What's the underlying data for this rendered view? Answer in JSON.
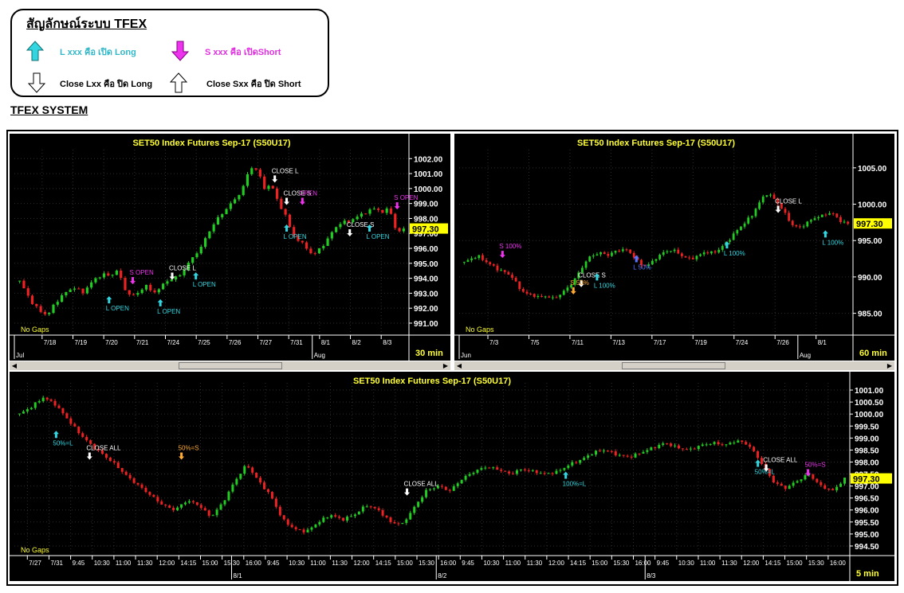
{
  "legend": {
    "title": "สัญลักษณ์ระบบ TFEX",
    "open_long": "L xxx คือ เปิด Long",
    "open_short": "S xxx คือ เปิดShort",
    "close_long": "Close Lxx คือ ปิด Long",
    "close_short": "Close Sxx คือ ปิด Short"
  },
  "system_title": "TFEX SYSTEM",
  "colors": {
    "up": "#22cc22",
    "down": "#ee2222",
    "long": "#33d6e0",
    "short": "#ee33ee",
    "close": "#ffffff",
    "partial": "#ffaa33",
    "blue": "#5577ff",
    "title": "#ffff33",
    "price_tag": "#ffff00"
  },
  "chart_data": [
    {
      "type": "candlestick",
      "title": "SET50  Index  Futures  Sep-17  (S50U17)",
      "timeframe": "30  min",
      "footer": "No  Gaps",
      "last_price": "997.30",
      "ylim": [
        990.2,
        1002.6
      ],
      "y_ticks": [
        "1002.00",
        "1001.00",
        "1000.00",
        "999.00",
        "998.00",
        "997.00",
        "996.00",
        "995.00",
        "994.00",
        "993.00",
        "992.00",
        "991.00"
      ],
      "x_ticks": [
        "7/18",
        "7/19",
        "7/20",
        "7/21",
        "7/24",
        "7/25",
        "7/26",
        "7/27",
        "7/31",
        "8/1",
        "8/2",
        "8/3"
      ],
      "sub_ticks": [
        "Jul",
        "Aug"
      ],
      "path": [
        993.8,
        993.0,
        992.2,
        991.8,
        991.5,
        992.3,
        992.8,
        993.2,
        993.4,
        993.0,
        993.6,
        994.0,
        994.3,
        994.1,
        994.6,
        993.3,
        992.8,
        993.0,
        993.6,
        993.0,
        993.3,
        993.8,
        994.0,
        994.2,
        994.9,
        995.5,
        996.1,
        997.0,
        997.8,
        998.3,
        998.9,
        999.3,
        1000.1,
        1001.4,
        1001.3,
        1000.0,
        1000.3,
        999.1,
        998.3,
        997.0,
        996.5,
        996.1,
        995.5,
        996.0,
        996.5,
        997.3,
        997.7,
        997.8,
        998.0,
        998.3,
        998.5,
        998.7,
        998.4,
        998.7,
        997.0,
        997.3
      ],
      "signals": [
        {
          "label": "L  OPEN",
          "kind": "long",
          "t": 0.24,
          "price": 992.8
        },
        {
          "label": "S  OPEN",
          "kind": "short",
          "t": 0.3,
          "price": 993.6
        },
        {
          "label": "L  OPEN",
          "kind": "long",
          "t": 0.37,
          "price": 992.6
        },
        {
          "label": "CLOSE L",
          "kind": "close",
          "t": 0.4,
          "price": 993.9
        },
        {
          "label": "L  OPEN",
          "kind": "long",
          "t": 0.46,
          "price": 994.4
        },
        {
          "label": "CLOSE  L",
          "kind": "close",
          "t": 0.66,
          "price": 1000.4
        },
        {
          "label": "CLOSE  S",
          "kind": "close",
          "t": 0.69,
          "price": 998.9
        },
        {
          "label": "OPEN",
          "kind": "short",
          "t": 0.73,
          "price": 998.9
        },
        {
          "label": "L  OPEN",
          "kind": "long",
          "t": 0.69,
          "price": 997.6
        },
        {
          "label": "CLOSE  S",
          "kind": "close",
          "t": 0.85,
          "price": 996.8
        },
        {
          "label": "L  OPEN",
          "kind": "long",
          "t": 0.9,
          "price": 997.6
        },
        {
          "label": "S  OPEN",
          "kind": "short",
          "t": 0.97,
          "price": 998.6
        }
      ]
    },
    {
      "type": "candlestick",
      "title": "SET50  Index  Futures  Sep-17  (S50U17)",
      "timeframe": "60  min",
      "footer": "No  Gaps",
      "last_price": "997.30",
      "ylim": [
        982.0,
        1007.5
      ],
      "y_ticks": [
        "1005.00",
        "1000.00",
        "995.00",
        "990.00",
        "985.00"
      ],
      "x_ticks": [
        "7/3",
        "7/5",
        "7/11",
        "7/13",
        "7/17",
        "7/19",
        "7/24",
        "7/26",
        "8/1"
      ],
      "sub_ticks": [
        "Jun",
        "Aug"
      ],
      "path": [
        992.0,
        992.5,
        992.9,
        992.2,
        991.6,
        991.0,
        990.6,
        990.0,
        988.5,
        987.7,
        987.5,
        987.2,
        987.4,
        987.0,
        987.6,
        988.4,
        989.5,
        991.0,
        992.5,
        993.1,
        993.3,
        993.0,
        993.5,
        993.8,
        993.6,
        992.5,
        991.5,
        991.7,
        992.6,
        993.3,
        993.7,
        993.5,
        992.7,
        992.5,
        992.8,
        993.4,
        993.3,
        993.6,
        994.5,
        995.5,
        996.6,
        997.5,
        998.5,
        1000.1,
        1001.5,
        1001.0,
        999.9,
        998.4,
        997.0,
        996.8,
        997.4,
        998.1,
        998.3,
        998.8,
        998.6,
        997.6,
        997.3
      ],
      "signals": [
        {
          "label": "S  100%",
          "kind": "short",
          "t": 0.11,
          "price": 992.6
        },
        {
          "label": "CLOSE  S",
          "kind": "close",
          "t": 0.31,
          "price": 988.6
        },
        {
          "label": "S  50%",
          "kind": "partial",
          "t": 0.29,
          "price": 987.6
        },
        {
          "label": "L  100%",
          "kind": "long",
          "t": 0.35,
          "price": 990.5
        },
        {
          "label": "L  50%",
          "kind": "blue",
          "t": 0.45,
          "price": 993.0
        },
        {
          "label": "L  100%",
          "kind": "long",
          "t": 0.68,
          "price": 994.9
        },
        {
          "label": "CLOSE  L",
          "kind": "close",
          "t": 0.81,
          "price": 998.8
        },
        {
          "label": "L  100%",
          "kind": "long",
          "t": 0.93,
          "price": 996.4
        }
      ]
    },
    {
      "type": "candlestick",
      "title": "SET50  Index  Futures  Sep-17  (S50U17)",
      "timeframe": "5  min",
      "footer": "No  Gaps",
      "last_price": "997.30",
      "ylim": [
        994.1,
        1001.3
      ],
      "y_ticks": [
        "1001.00",
        "1000.50",
        "1000.00",
        "999.50",
        "999.00",
        "998.50",
        "998.00",
        "997.50",
        "997.00",
        "996.50",
        "996.00",
        "995.50",
        "995.00",
        "994.50"
      ],
      "x_ticks": [
        "7/27",
        "7/31",
        "9:45",
        "10:30",
        "11:00",
        "11:30",
        "12:00",
        "14:15",
        "15:00",
        "15:30",
        "16:00",
        "9:45",
        "10:30",
        "11:00",
        "11:30",
        "12:00",
        "14:15",
        "15:00",
        "15:30",
        "16:00",
        "9:45",
        "10:30",
        "11:00",
        "11:30",
        "12:00",
        "14:15",
        "15:00",
        "15:30",
        "16:00",
        "9:45",
        "10:30",
        "11:00",
        "11:30",
        "12:00",
        "14:15",
        "15:00",
        "15:30",
        "16:00"
      ],
      "sub_ticks": [
        "8/1",
        "8/2",
        "8/3"
      ],
      "path": [
        1000.0,
        1000.3,
        1000.7,
        1000.4,
        999.8,
        999.2,
        998.7,
        998.3,
        997.9,
        997.4,
        997.0,
        996.6,
        996.2,
        996.0,
        996.4,
        996.2,
        995.7,
        996.3,
        997.2,
        997.9,
        997.2,
        996.6,
        995.6,
        995.2,
        995.1,
        995.5,
        995.8,
        995.6,
        995.8,
        996.2,
        996.0,
        995.5,
        995.4,
        996.1,
        996.8,
        997.0,
        996.8,
        997.3,
        997.6,
        997.8,
        997.7,
        997.5,
        997.7,
        997.6,
        997.5,
        997.6,
        997.9,
        998.1,
        998.4,
        998.5,
        998.3,
        998.2,
        998.4,
        998.6,
        998.8,
        998.6,
        998.5,
        998.7,
        998.8,
        998.7,
        998.9,
        998.7,
        998.0,
        997.2,
        996.9,
        997.2,
        997.5,
        997.0,
        996.8,
        997.3
      ],
      "signals": [
        {
          "label": "50%=L",
          "kind": "long",
          "t": 0.05,
          "price": 999.3
        },
        {
          "label": "CLOSE  ALL",
          "kind": "close",
          "t": 0.09,
          "price": 998.1
        },
        {
          "label": "50%=S",
          "kind": "partial",
          "t": 0.2,
          "price": 998.1
        },
        {
          "label": "CLOSE  ALL",
          "kind": "close",
          "t": 0.47,
          "price": 996.6
        },
        {
          "label": "100%=L",
          "kind": "long",
          "t": 0.66,
          "price": 997.6
        },
        {
          "label": "50%=L",
          "kind": "long",
          "t": 0.89,
          "price": 998.1
        },
        {
          "label": "CLOSE  ALL",
          "kind": "close",
          "t": 0.9,
          "price": 997.6
        },
        {
          "label": "50%=S",
          "kind": "short",
          "t": 0.95,
          "price": 997.4
        }
      ]
    }
  ]
}
